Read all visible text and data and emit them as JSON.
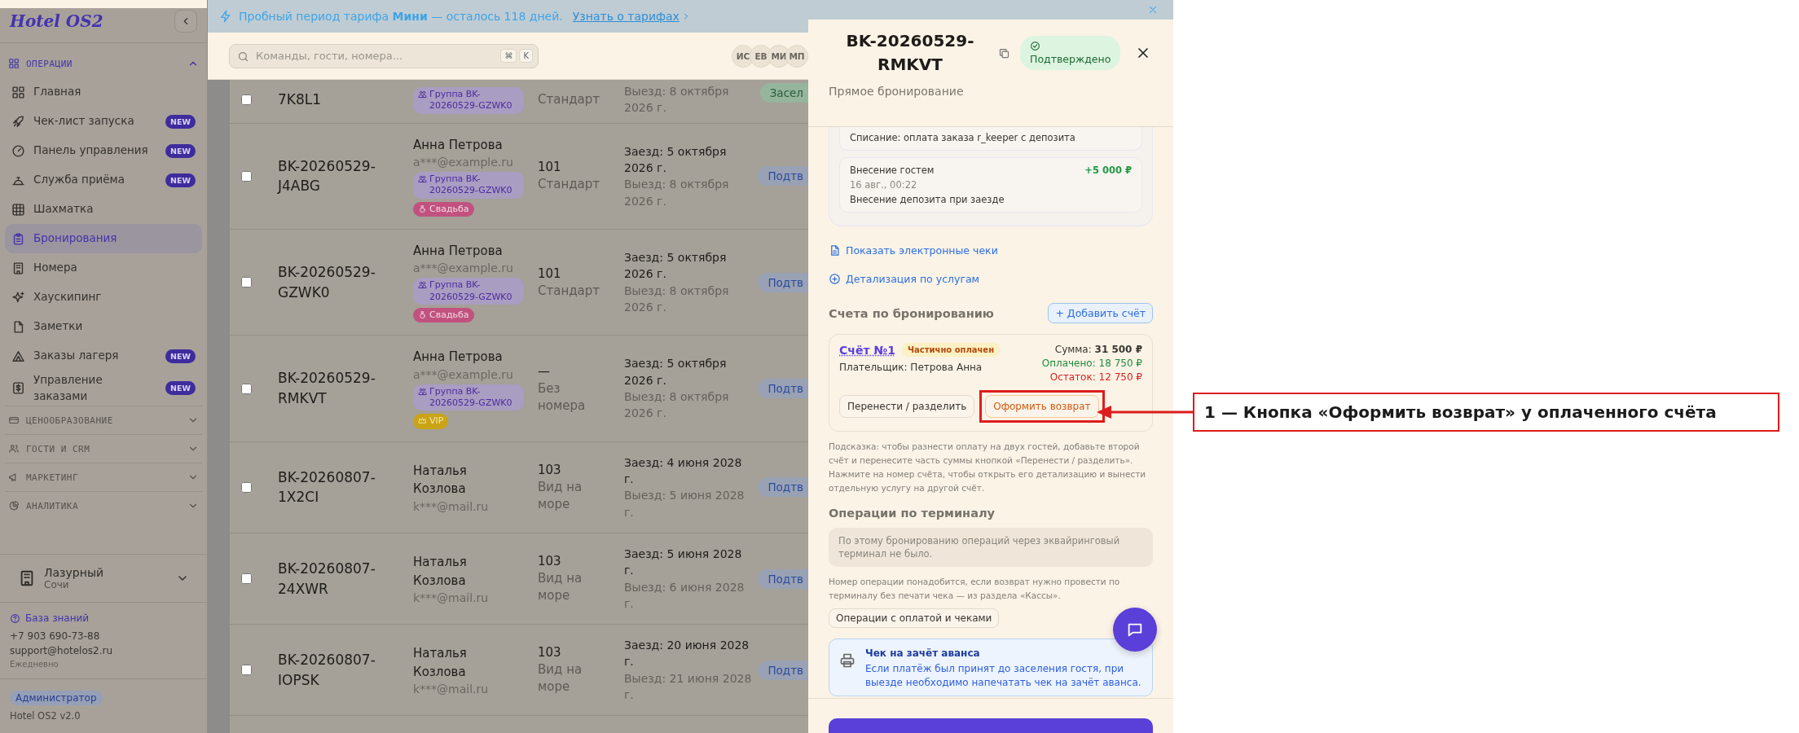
{
  "banner": {
    "text": "Пробный период тарифа **Мини** — осталось 118 дней.",
    "link": "Узнать о тарифах"
  },
  "sidebar": {
    "logo": "Hotel OS2",
    "sections": [
      {
        "title": "ОПЕРАЦИИ",
        "expanded": true,
        "items": [
          {
            "label": "Главная",
            "selected": false
          },
          {
            "label": "Чек-лист запуска",
            "badge": "NEW",
            "selected": false
          },
          {
            "label": "Панель управления",
            "badge": "NEW",
            "selected": false
          },
          {
            "label": "Служба приёма",
            "badge": "NEW",
            "selected": false
          },
          {
            "label": "Шахматка",
            "selected": false
          },
          {
            "label": "Бронирования",
            "selected": true
          },
          {
            "label": "Номера",
            "selected": false
          },
          {
            "label": "Хаускипинг",
            "selected": false
          },
          {
            "label": "Заметки",
            "selected": false
          },
          {
            "label": "Заказы лагеря",
            "badge": "NEW",
            "selected": false
          },
          {
            "label": "Управление заказами",
            "badge": "NEW",
            "selected": false
          }
        ]
      },
      {
        "title": "ЦЕНООБРАЗОВАНИЕ",
        "expanded": false
      },
      {
        "title": "ГОСТИ И CRM",
        "expanded": false
      },
      {
        "title": "МАРКЕТИНГ",
        "expanded": false
      },
      {
        "title": "АНАЛИТИКА",
        "expanded": false
      }
    ],
    "hotel": {
      "name": "Лазурный",
      "city": "Сочи"
    },
    "support": {
      "link": "База знаний",
      "phone": "+7 903 690-73-88",
      "email": "support@hotelos2.ru",
      "hours": "Ежедневно"
    },
    "role": "Администратор",
    "version": "Hotel OS2 v2.0"
  },
  "header": {
    "search": {
      "placeholder": "Команды, гости, номера..."
    },
    "keys": [
      "⌘",
      "K"
    ],
    "avatars": [
      "ИС",
      "ЕВ",
      "МИ",
      "МП"
    ]
  },
  "bookings": [
    {
      "selected": false,
      "id": "7K8L1",
      "tags": [
        {
          "kind": "group",
          "label": "Группа BK-20260529-GZWK0"
        }
      ],
      "room_type": "Стандарт",
      "checkout": "Выезд: 8 октября 2026 г.",
      "status": "Засел",
      "color": "#95b59c"
    },
    {
      "selected": false,
      "id": "BK-20260529-J4ABG",
      "guest": "Анна Петрова",
      "email": "a***@example.ru",
      "tags": [
        {
          "kind": "group",
          "label": "Группа BK-20260529-GZWK0"
        },
        {
          "kind": "wedding",
          "label": "Свадьба"
        }
      ],
      "room": "101",
      "room_type": "Стандарт",
      "checkin": "Заезд: 5 октября 2026 г.",
      "checkout": "Выезд: 8 октября 2026 г.",
      "status": "Подтв",
      "color": "#98a2b4"
    },
    {
      "selected": false,
      "id": "BK-20260529-GZWK0",
      "guest": "Анна Петрова",
      "email": "a***@example.ru",
      "tags": [
        {
          "kind": "group",
          "label": "Группа BK-20260529-GZWK0"
        },
        {
          "kind": "wedding",
          "label": "Свадьба"
        }
      ],
      "room": "101",
      "room_type": "Стандарт",
      "checkin": "Заезд: 5 октября 2026 г.",
      "checkout": "Выезд: 8 октября 2026 г.",
      "status": "Подтв",
      "color": "#98a2b4"
    },
    {
      "selected": false,
      "id": "BK-20260529-RMKVT",
      "guest": "Анна Петрова",
      "email": "a***@example.ru",
      "tags": [
        {
          "kind": "group",
          "label": "Группа BK-20260529-GZWK0"
        },
        {
          "kind": "vip",
          "label": "VIP"
        }
      ],
      "room": "—",
      "room_type": "Без номера",
      "checkin": "Заезд: 5 октября 2026 г.",
      "checkout": "Выезд: 8 октября 2026 г.",
      "status": "Подтв",
      "color": "#98a2b4"
    },
    {
      "selected": false,
      "id": "BK-20260807-1X2CI",
      "guest": "Наталья Козлова",
      "email": "k***@mail.ru",
      "room": "103",
      "room_type": "Вид на море",
      "checkin": "Заезд: 4 июня 2028 г.",
      "checkout": "Выезд: 5 июня 2028 г.",
      "status": "Подтв",
      "color": "#98a2b4"
    },
    {
      "selected": false,
      "id": "BK-20260807-24XWR",
      "guest": "Наталья Козлова",
      "email": "k***@mail.ru",
      "room": "103",
      "room_type": "Вид на море",
      "checkin": "Заезд: 5 июня 2028 г.",
      "checkout": "Выезд: 6 июня 2028 г.",
      "status": "Подтв",
      "color": "#98a2b4"
    },
    {
      "selected": false,
      "id": "BK-20260807-IOPSK",
      "guest": "Наталья Козлова",
      "email": "k***@mail.ru",
      "room": "103",
      "room_type": "Вид на море",
      "checkin": "Заезд: 20 июня 2028 г.",
      "checkout": "Выезд: 21 июня 2028 г.",
      "status": "Подтв",
      "color": "#98a2b4"
    }
  ],
  "drawer": {
    "title": "BK-20260529-RMKVT",
    "status": "Подтверждено",
    "subtitle": "Прямое бронирование",
    "transactions": [
      {
        "description": "Списание: оплата заказа r_keeper с депозита"
      },
      {
        "title": "Внесение гостем",
        "amount": "+5 000 ₽",
        "time": "16 авг., 00:22",
        "description": "Внесение депозита при заезде"
      }
    ],
    "links": [
      "Показать электронные чеки",
      "Детализация по услугам"
    ],
    "invoices_title": "Счета по бронированию",
    "add_invoice": "+ Добавить счёт",
    "invoices": [
      {
        "number": "Счёт №1",
        "status": "Частично оплачен",
        "total": "Сумма: **31 500 ₽**",
        "paid": "Оплачено: 18 750 ₽",
        "balance": "Остаток: 12 750 ₽",
        "payer": "Плательщик: Петрова Анна",
        "actions": [
          {
            "label": "Перенести / разделить",
            "kind": "neutral",
            "highlighted": false
          },
          {
            "label": "Оформить возврат",
            "kind": "refund",
            "highlighted": true
          }
        ]
      }
    ],
    "hint": "Подсказка: чтобы разнести оплату на двух гостей, добавьте второй счёт и перенесите часть суммы кнопкой «Перенести / разделить». Нажмите на номер счёта, чтобы открыть его детализацию и вынести отдельную услугу на другой счёт.",
    "terminal_title": "Операции по терминалу",
    "terminal_empty": "По этому бронированию операций через эквайринговый терминал не было.",
    "terminal_note": "Номер операции понадобится, если возврат нужно провести по терминалу без печати чека — из раздела «Кассы».",
    "terminal_button": "Операции с оплатой и чеками",
    "advance": {
      "title": "Чек на зачёт аванса",
      "text": "Если платёж был принят до заселения гостя, при выезде необходимо напечатать чек на зачёт аванса."
    }
  },
  "callout": {
    "label": "1 — Кнопка «Оформить возврат» у оплаченного счёта"
  }
}
